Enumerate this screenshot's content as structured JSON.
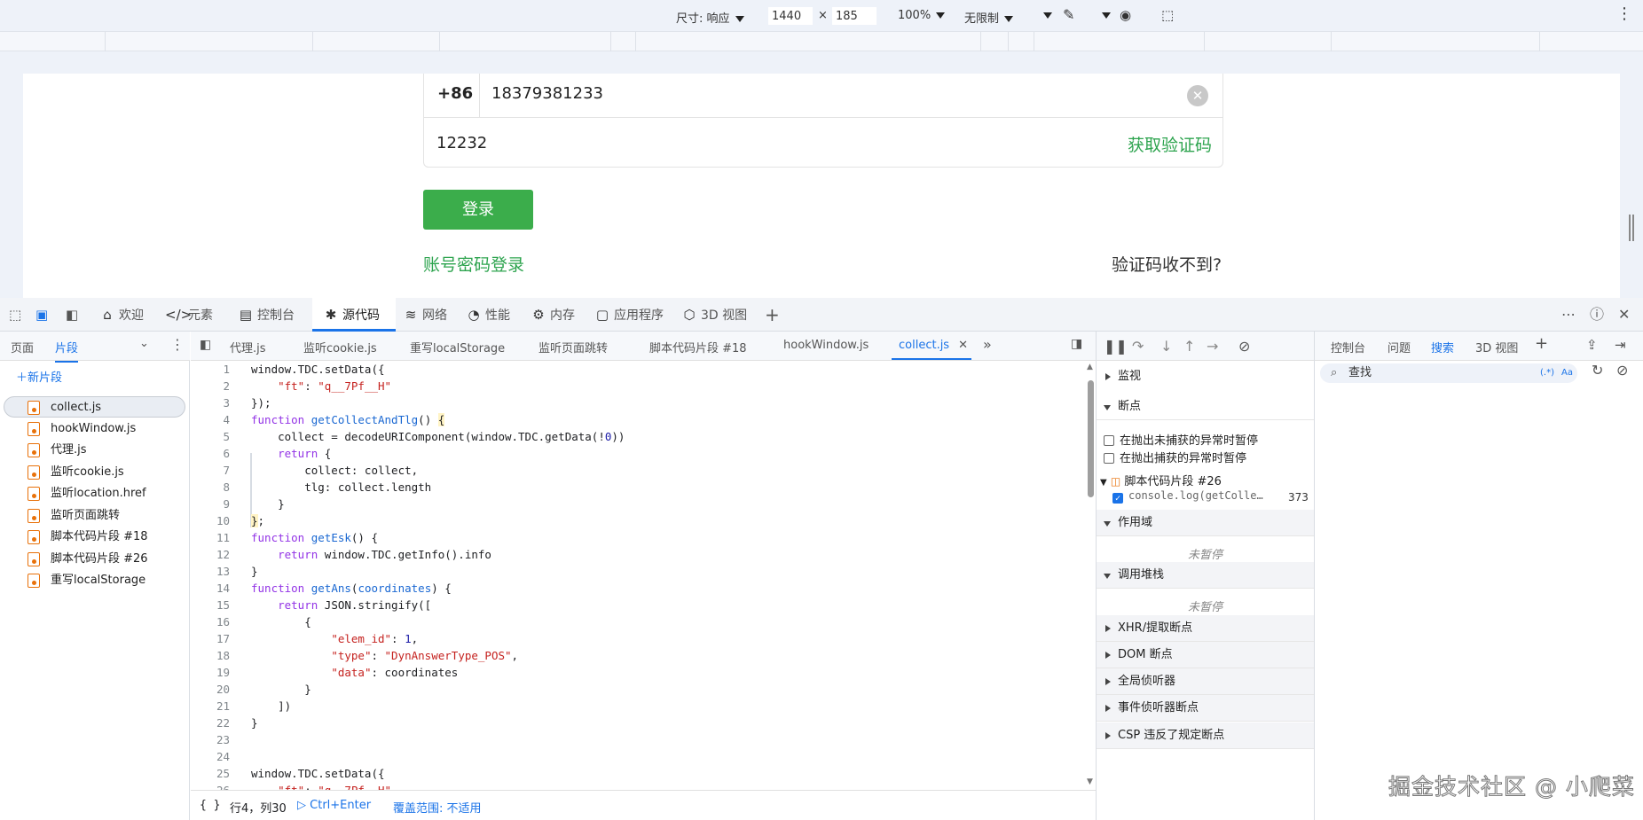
{
  "device_toolbar": {
    "size_label": "尺寸: 响应",
    "width": "1440",
    "times": "×",
    "height": "185",
    "zoom": "100%",
    "throttle": "无限制"
  },
  "page": {
    "country_code": "+86",
    "phone": "18379381233",
    "clear_glyph": "✕",
    "code_value": "12232",
    "get_code": "获取验证码",
    "login": "登录",
    "password_login": "账号密码登录",
    "no_code": "验证码收不到?"
  },
  "devtools_tabs": [
    {
      "label": "欢迎",
      "icon": "home-icon",
      "glyph": "⌂"
    },
    {
      "label": "元素",
      "icon": "elements-icon",
      "glyph": "</>"
    },
    {
      "label": "控制台",
      "icon": "console-icon",
      "glyph": "▤"
    },
    {
      "label": "源代码",
      "icon": "sources-icon",
      "glyph": "✱"
    },
    {
      "label": "网络",
      "icon": "network-icon",
      "glyph": "≋"
    },
    {
      "label": "性能",
      "icon": "performance-icon",
      "glyph": "◔"
    },
    {
      "label": "内存",
      "icon": "memory-icon",
      "glyph": "⚙"
    },
    {
      "label": "应用程序",
      "icon": "application-icon",
      "glyph": "▢"
    },
    {
      "label": "3D 视图",
      "icon": "3d-view-icon",
      "glyph": "⬡"
    }
  ],
  "navigator": {
    "tabs": [
      "页面",
      "片段"
    ],
    "new_snippet": "新片段",
    "files": [
      "collect.js",
      "hookWindow.js",
      "代理.js",
      "监听cookie.js",
      "监听location.href",
      "监听页面跳转",
      "脚本代码片段 #18",
      "脚本代码片段 #26",
      "重写localStorage"
    ]
  },
  "editor": {
    "tabs": [
      "代理.js",
      "监听cookie.js",
      "重写localStorage",
      "监听页面跳转",
      "脚本代码片段 #18",
      "hookWindow.js",
      "collect.js"
    ],
    "line_numbers": [
      "1",
      "2",
      "3",
      "4",
      "5",
      "6",
      "7",
      "8",
      "9",
      "10",
      "11",
      "12",
      "13",
      "14",
      "15",
      "16",
      "17",
      "18",
      "19",
      "20",
      "21",
      "22",
      "23",
      "24",
      "25",
      "26"
    ],
    "status": {
      "braces": "{ }",
      "position": "行4，列30",
      "run": "Ctrl+Enter",
      "coverage": "覆盖范围: 不适用"
    }
  },
  "debugger": {
    "watch": "监视",
    "breakpoints": "断点",
    "pause_uncaught": "在抛出未捕获的异常时暂停",
    "pause_caught": "在抛出捕获的异常时暂停",
    "snippet": "脚本代码片段 #26",
    "bp_code": "console.log(getColle…",
    "bp_line": "373",
    "scope": "作用域",
    "not_paused": "未暂停",
    "call_stack": "调用堆栈",
    "not_paused2": "未暂停",
    "xhr": "XHR/提取断点",
    "dom": "DOM 断点",
    "global": "全局侦听器",
    "event": "事件侦听器断点",
    "csp": "CSP 违反了规定断点"
  },
  "drawer": {
    "tabs": [
      "控制台",
      "问题",
      "搜索",
      "3D 视图"
    ],
    "search_placeholder": "查找",
    "regex": "(.*)",
    "case": "Aa"
  },
  "watermark": "掘金技术社区 @ 小爬菜"
}
